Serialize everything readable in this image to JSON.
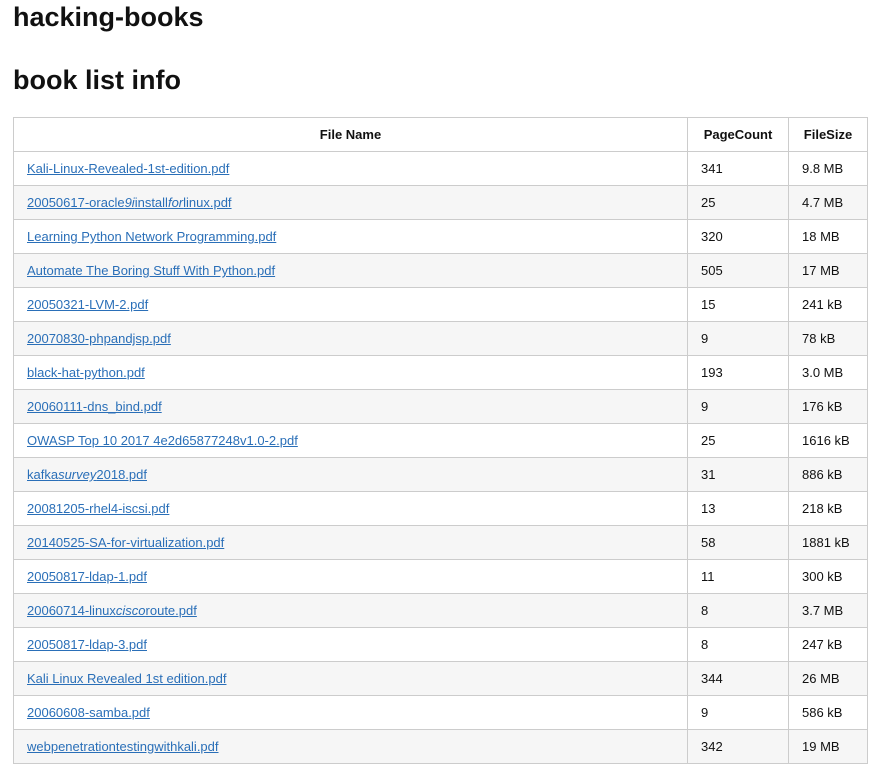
{
  "header": {
    "site_title": "hacking-books",
    "section_title": "book list info"
  },
  "table": {
    "columns": [
      "File Name",
      "PageCount",
      "FileSize"
    ],
    "rows": [
      {
        "name": [
          {
            "t": "Kali-Linux-Revealed-1st-edition.pdf"
          }
        ],
        "pages": "341",
        "size": "9.8 MB"
      },
      {
        "name": [
          {
            "t": "20050617-oracle"
          },
          {
            "t": "9i",
            "em": true
          },
          {
            "t": "install"
          },
          {
            "t": "for",
            "em": true
          },
          {
            "t": "linux.pdf"
          }
        ],
        "pages": "25",
        "size": "4.7 MB"
      },
      {
        "name": [
          {
            "t": "Learning Python Network Programming.pdf"
          }
        ],
        "pages": "320",
        "size": "18 MB"
      },
      {
        "name": [
          {
            "t": "Automate The Boring Stuff With Python.pdf"
          }
        ],
        "pages": "505",
        "size": "17 MB"
      },
      {
        "name": [
          {
            "t": "20050321-LVM-2.pdf"
          }
        ],
        "pages": "15",
        "size": "241 kB"
      },
      {
        "name": [
          {
            "t": "20070830-phpandjsp.pdf"
          }
        ],
        "pages": "9",
        "size": "78 kB"
      },
      {
        "name": [
          {
            "t": "black-hat-python.pdf"
          }
        ],
        "pages": "193",
        "size": "3.0 MB"
      },
      {
        "name": [
          {
            "t": "20060111-dns_bind.pdf"
          }
        ],
        "pages": "9",
        "size": "176 kB"
      },
      {
        "name": [
          {
            "t": "OWASP Top 10 2017 4e2d65877248v1.0-2.pdf"
          }
        ],
        "pages": "25",
        "size": "1616 kB"
      },
      {
        "name": [
          {
            "t": "kafka"
          },
          {
            "t": "survey",
            "em": true
          },
          {
            "t": "2018.pdf"
          }
        ],
        "pages": "31",
        "size": "886 kB"
      },
      {
        "name": [
          {
            "t": "20081205-rhel4-iscsi.pdf"
          }
        ],
        "pages": "13",
        "size": "218 kB"
      },
      {
        "name": [
          {
            "t": "20140525-SA-for-virtualization.pdf"
          }
        ],
        "pages": "58",
        "size": "1881 kB"
      },
      {
        "name": [
          {
            "t": "20050817-ldap-1.pdf"
          }
        ],
        "pages": "11",
        "size": "300 kB"
      },
      {
        "name": [
          {
            "t": "20060714-linux"
          },
          {
            "t": "cisco",
            "em": true
          },
          {
            "t": "route.pdf"
          }
        ],
        "pages": "8",
        "size": "3.7 MB"
      },
      {
        "name": [
          {
            "t": "20050817-ldap-3.pdf"
          }
        ],
        "pages": "8",
        "size": "247 kB"
      },
      {
        "name": [
          {
            "t": "Kali Linux Revealed 1st edition.pdf"
          }
        ],
        "pages": "344",
        "size": "26 MB"
      },
      {
        "name": [
          {
            "t": "20060608-samba.pdf"
          }
        ],
        "pages": "9",
        "size": "586 kB"
      },
      {
        "name": [
          {
            "t": "webpenetrationtestingwithkali.pdf"
          }
        ],
        "pages": "342",
        "size": "19 MB"
      }
    ]
  }
}
